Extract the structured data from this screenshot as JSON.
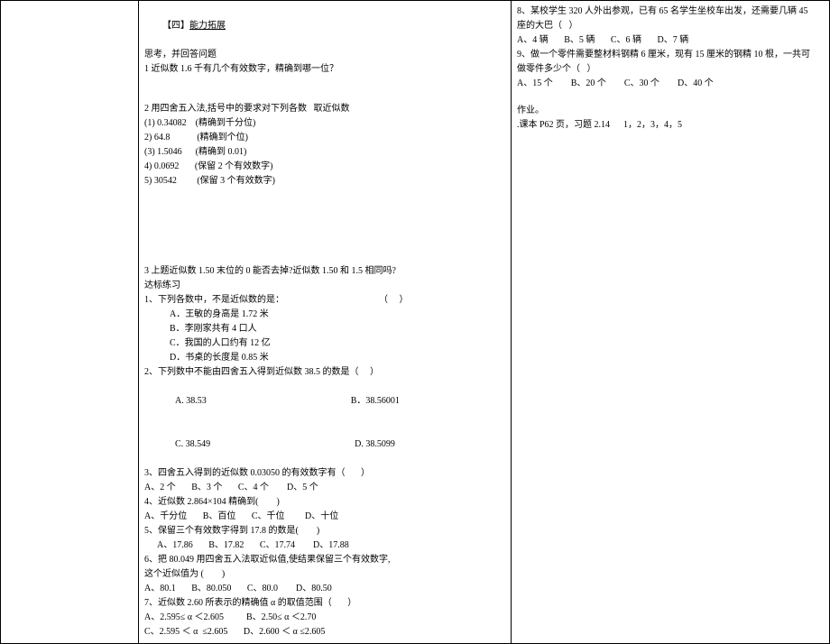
{
  "left": {
    "sectionLabel": "【四】",
    "sectionTitle": "能力拓展",
    "think": "思考，并回答问题",
    "q1": "1 近似数 1.6 千有几个有效数字，精确到哪一位？",
    "q2": "2 用四舍五入法,括号中的要求对下列各数   取近似数",
    "q2_1": "(1) 0.34082    (精确到千分位)",
    "q2_2": "2) 64.8            (精确到个位)",
    "q2_3": "(3) 1.5046      (精确到 0.01)",
    "q2_4": "4) 0.0692       (保留 2 个有效数字)",
    "q2_5": "5) 30542         (保留 3 个有效数字)",
    "q3": "3 上题近似数 1.50 末位的 0 能否去掉?近似数 1.50 和 1.5 相同吗?",
    "db": "达标练习",
    "p1": "1、下列各数中，不是近似数的是：                                          （     ）",
    "p1a": "A．王敏的身高是 1.72 米",
    "p1b": "B．李刚家共有 4 口人",
    "p1c": "C．我国的人口约有 12 亿",
    "p1d": "D．书桌的长度是 0.85 米",
    "p2": "2、下列数中不能由四舍五入得到近似数 38.5 的数是（     ）",
    "p2a": "A. 38.53",
    "p2b": "B．38.56001",
    "p2c": "C. 38.549",
    "p2d": "D. 38.5099",
    "p3": "3、四舍五入得到的近似数 0.03050 的有效数字有（       ）",
    "p3opts": "A、2 个       B、3 个       C、4 个        D、5 个",
    "p4": "4、近似数 2.864×104 精确到(        )",
    "p4opts": "A、千分位       B、百位       C、千位         D、十位",
    "p5": "5、保留三个有效数字得到 17.8 的数是(        )",
    "p5opts": "A、17.86       B、17.82       C、17.74        D、17.88",
    "p6a": "6、把 80.049 用四舍五入法取近似值,使结果保留三个有效数字,",
    "p6b": "这个近似值为 (        )",
    "p6opts": "A、80.1       B、80.050       C、80.0        D、80.50",
    "p7": "7、近似数 2.60 所表示的精确值 α 的取值范围（       ）",
    "p7ab": "A、2.595≤ α ＜2.605          B、2.50≤ α ＜2.70",
    "p7cd": "C、2.595 ＜ α  ≤2.605       D、2.600 ＜ α ≤2.605"
  },
  "right": {
    "p8a": "8、某校学生 320 人外出参观，已有 65 名学生坐校车出发，还需要几辆 45",
    "p8b": "座的大巴（   ）",
    "p8opts": "A、4 辆       B、5 辆       C、6 辆       D、7 辆",
    "p9a": "9、做一个零件需要整材料钢精 6 厘米，现有 15 厘米的钢精 10 根，一共可",
    "p9b": "做零件多少个（   ）",
    "p9opts": "A、15 个        B、20 个        C、30 个        D、40 个",
    "hw": "作业。",
    "hwline": ".课本 P62 页，习题 2.14      1，2，3，4，5"
  }
}
